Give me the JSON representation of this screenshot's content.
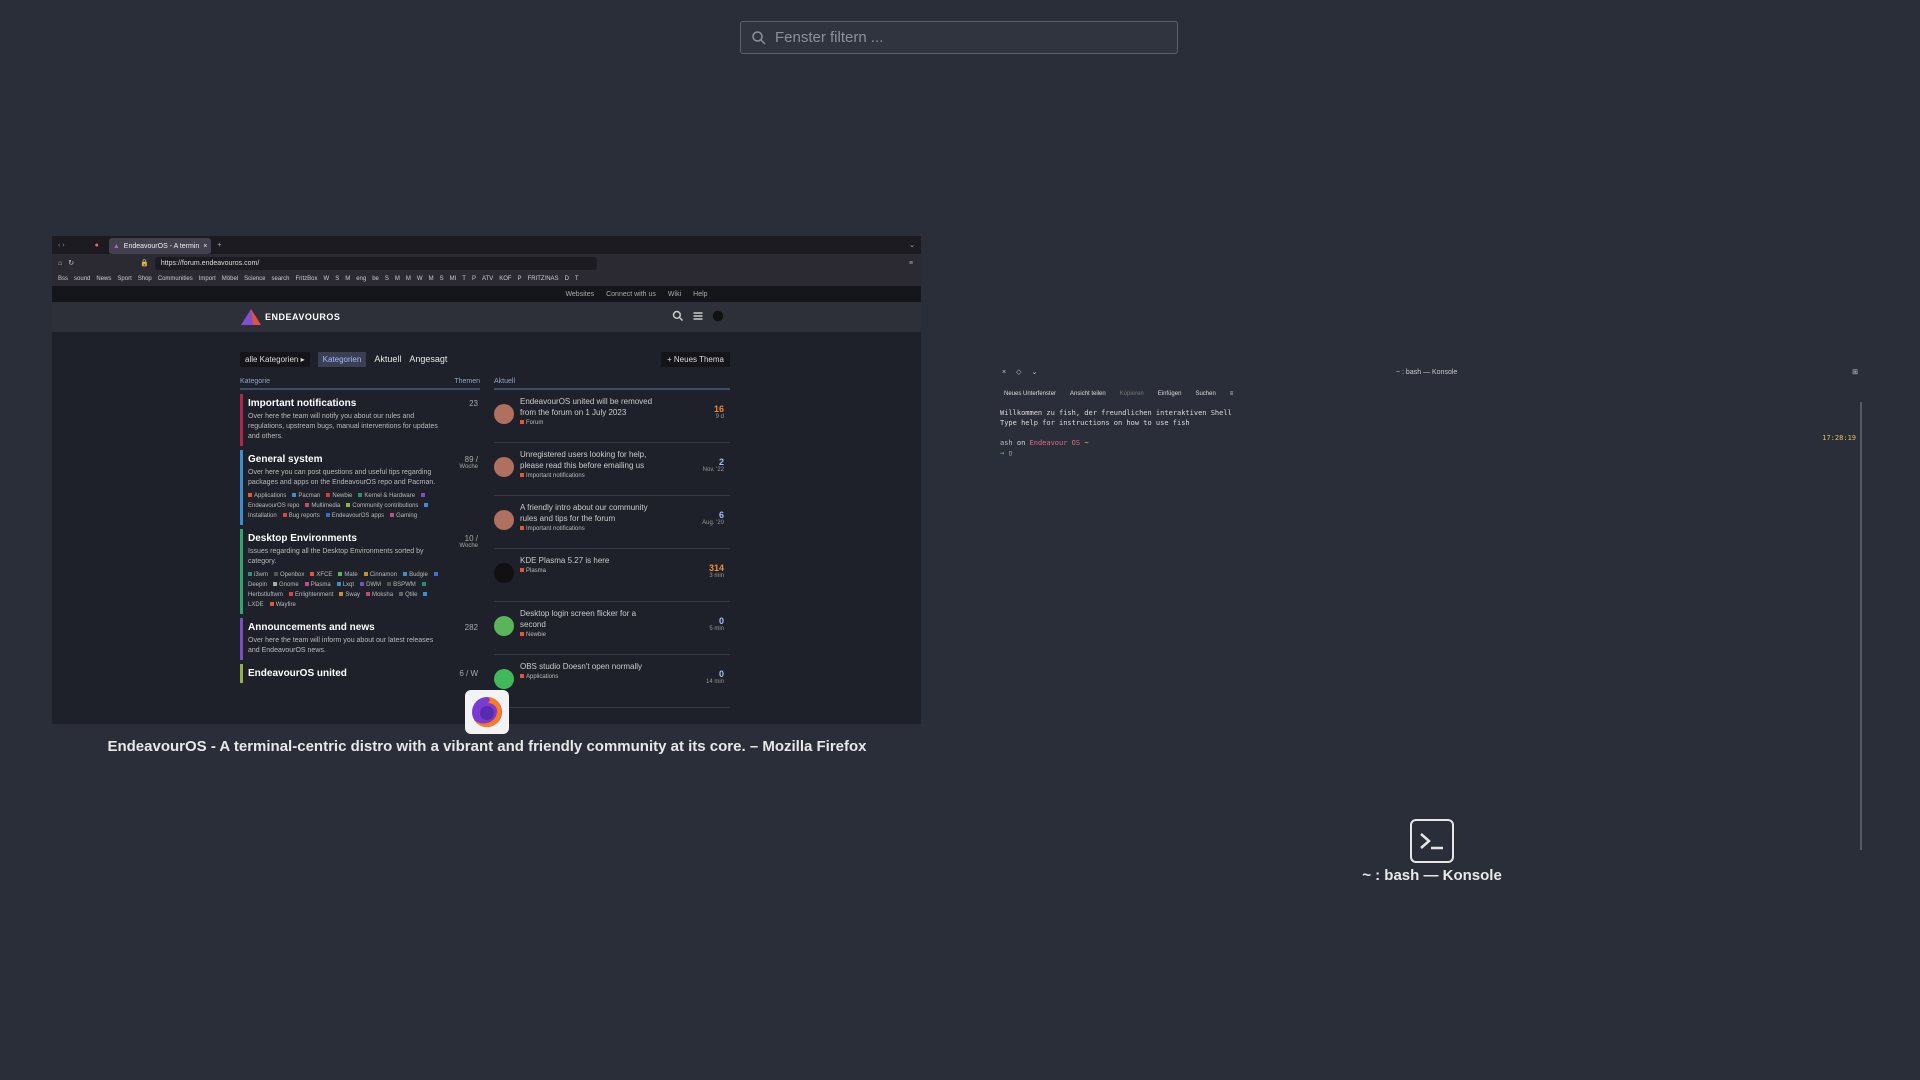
{
  "filter": {
    "placeholder": "Fenster filtern ..."
  },
  "firefox": {
    "tab_title": "EndeavourOS - A termin",
    "url": "https://forum.endeavouros.com/",
    "bookmarks": [
      "Bss",
      "sound",
      "News",
      "Sport",
      "Shop",
      "Communities",
      "Import",
      "Möbel",
      "Science",
      "search",
      "FritzBox",
      "W",
      "S",
      "M",
      "eng",
      "be",
      "S",
      "M",
      "M",
      "W",
      "M",
      "S",
      "MI",
      "T",
      "P",
      "ATV",
      "KOF",
      "P",
      "FRITZ!NAS",
      "D",
      "T"
    ],
    "top_nav": [
      "Websites",
      "Connect with us",
      "Wiki",
      "Help"
    ],
    "logo": "ENDEAVOUROS",
    "nav": {
      "all": "alle Kategorien",
      "tabs": [
        "Kategorien",
        "Aktuell",
        "Angesagt"
      ],
      "new_topic": "Neues Thema"
    },
    "col_headers": {
      "category": "Kategorie",
      "topics": "Themen",
      "latest": "Aktuell"
    },
    "categories": [
      {
        "title": "Important notifications",
        "desc": "Over here the team will notify you about our rules and regulations, upstream bugs, manual interventions for updates and others.",
        "count": "23",
        "per": "",
        "color": "#b3254a",
        "subs": []
      },
      {
        "title": "General system",
        "desc": "Over here you can post questions and useful tips regarding packages and apps on the EndeavourOS repo and Pacman.",
        "count": "89 /",
        "per": "Woche",
        "color": "#3b8fd0",
        "subs": [
          {
            "name": "Applications",
            "color": "#e45735"
          },
          {
            "name": "Pacman",
            "color": "#3b8fd0"
          },
          {
            "name": "Newbie",
            "color": "#d63a3a"
          },
          {
            "name": "Kernel & Hardware",
            "color": "#2d8f6f"
          },
          {
            "name": "EndeavourOS repo",
            "color": "#7b4fc0"
          },
          {
            "name": "Multimedia",
            "color": "#c74a6a"
          },
          {
            "name": "Community contributions",
            "color": "#94b24a"
          },
          {
            "name": "Installation",
            "color": "#3b8fd0"
          },
          {
            "name": "Bug reports",
            "color": "#e04040"
          },
          {
            "name": "EndeavourOS apps",
            "color": "#2e6fd0"
          },
          {
            "name": "Gaming",
            "color": "#c04a8a"
          }
        ]
      },
      {
        "title": "Desktop Environments",
        "desc": "Issues regarding all the Desktop Environments sorted by category.",
        "count": "10 /",
        "per": "Woche",
        "color": "#2fa66b",
        "subs": [
          {
            "name": "i3wm",
            "color": "#2d8f6f"
          },
          {
            "name": "Openbox",
            "color": "#555"
          },
          {
            "name": "XFCE",
            "color": "#e45735"
          },
          {
            "name": "Mate",
            "color": "#5ab45a"
          },
          {
            "name": "Cinnamon",
            "color": "#c8902a"
          },
          {
            "name": "Budgie",
            "color": "#3b8fd0"
          },
          {
            "name": "Deepin",
            "color": "#3b6fd0"
          },
          {
            "name": "Gnome",
            "color": "#aaa"
          },
          {
            "name": "Plasma",
            "color": "#c04a8a"
          },
          {
            "name": "Lxqt",
            "color": "#3b8fd0"
          },
          {
            "name": "DWM",
            "color": "#7b4fc0"
          },
          {
            "name": "BSPWM",
            "color": "#555"
          },
          {
            "name": "Herbstluftwm",
            "color": "#2d8f6f"
          },
          {
            "name": "Enlightenment",
            "color": "#e04040"
          },
          {
            "name": "Sway",
            "color": "#c8902a"
          },
          {
            "name": "Moksha",
            "color": "#c74a6a"
          },
          {
            "name": "Qtile",
            "color": "#666"
          },
          {
            "name": "LXDE",
            "color": "#3b8fd0"
          },
          {
            "name": "Wayfire",
            "color": "#e45735"
          }
        ]
      },
      {
        "title": "Announcements and news",
        "desc": "Over here the team will inform you about our latest releases and EndeavourOS news.",
        "count": "282",
        "per": "",
        "color": "#7b4fc0",
        "subs": []
      },
      {
        "title": "EndeavourOS united",
        "desc": "",
        "count": "6 / W",
        "per": "",
        "color": "#94b24a",
        "subs": []
      }
    ],
    "topics": [
      {
        "title": "EndeavourOS united will be removed from the forum on 1 July 2023",
        "cat": "Forum",
        "count": "16",
        "age": "9 d",
        "hot": true,
        "avatar": "#b07060"
      },
      {
        "title": "Unregistered users looking for help, please read this before emailing us",
        "cat": "Important notifications",
        "count": "2",
        "age": "Nov. '22",
        "hot": false,
        "avatar": "#b07060"
      },
      {
        "title": "A friendly intro about our community rules and tips for the forum",
        "cat": "Important notifications",
        "count": "6",
        "age": "Aug. '20",
        "hot": false,
        "avatar": "#b07060"
      },
      {
        "title": "KDE Plasma 5.27 is here",
        "cat": "Plasma",
        "count": "314",
        "age": "3 min",
        "hot": true,
        "avatar": "#111111"
      },
      {
        "title": "Desktop login screen flicker for a second",
        "cat": "Newbie",
        "count": "0",
        "age": "5 min",
        "hot": false,
        "avatar": "#5ab45a"
      },
      {
        "title": "OBS studio Doesn't open normally",
        "cat": "Applications",
        "count": "0",
        "age": "14 min",
        "hot": false,
        "avatar": "#3fb95a"
      }
    ],
    "caption": "EndeavourOS - A terminal-centric distro with a vibrant and friendly community at its core. – Mozilla Firefox"
  },
  "konsole": {
    "title": "~ : bash — Konsole",
    "toolbar": [
      "Neues Unterfenster",
      "Ansicht teilen",
      "Kopieren",
      "Einfügen",
      "Suchen"
    ],
    "line1": "Willkommen zu fish, der freundlichen interaktiven Shell",
    "line2": "Type help for instructions on how to use fish",
    "prompt_user": "ash",
    "prompt_host": "Endeavour OS",
    "time": "17:28:19",
    "caption": "~ : bash — Konsole"
  }
}
